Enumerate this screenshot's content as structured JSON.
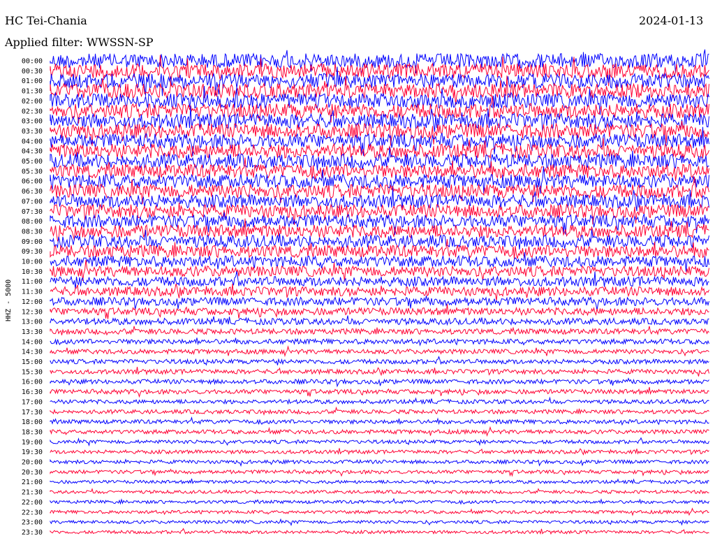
{
  "header": {
    "station": "HC Tei-Chania",
    "filter": "Applied filter: WWSSN-SP",
    "date": "2024-01-13"
  },
  "chart_data": {
    "type": "seismogram",
    "channel_label": "HHZ - 5000",
    "row_labels": [
      "00:00",
      "00:30",
      "01:00",
      "01:30",
      "02:00",
      "02:30",
      "03:00",
      "03:30",
      "04:00",
      "04:30",
      "05:00",
      "05:30",
      "06:00",
      "06:30",
      "07:00",
      "07:30",
      "08:00",
      "08:30",
      "09:00",
      "09:30",
      "10:00",
      "10:30",
      "11:00",
      "11:30",
      "12:00",
      "12:30",
      "13:00",
      "13:30",
      "14:00",
      "14:30",
      "15:00",
      "15:30",
      "16:00",
      "16:30",
      "17:00",
      "17:30",
      "18:00",
      "18:30",
      "19:00",
      "19:30",
      "20:00",
      "20:30",
      "21:00",
      "21:30",
      "22:00",
      "22:30",
      "23:00",
      "23:30"
    ],
    "trace_colors": [
      "#0000ff",
      "#ff0033"
    ],
    "noise_level": [
      1.6,
      1.6,
      1.6,
      1.6,
      1.6,
      1.6,
      1.6,
      1.6,
      1.55,
      1.55,
      1.55,
      1.5,
      1.5,
      1.5,
      1.45,
      1.45,
      1.4,
      1.4,
      1.35,
      1.35,
      1.2,
      1.15,
      1.05,
      1.0,
      0.9,
      0.8,
      0.7,
      0.6,
      0.55,
      0.5,
      0.5,
      0.5,
      0.5,
      0.5,
      0.45,
      0.45,
      0.45,
      0.45,
      0.4,
      0.4,
      0.4,
      0.4,
      0.35,
      0.35,
      0.35,
      0.35,
      0.35,
      0.35
    ]
  }
}
